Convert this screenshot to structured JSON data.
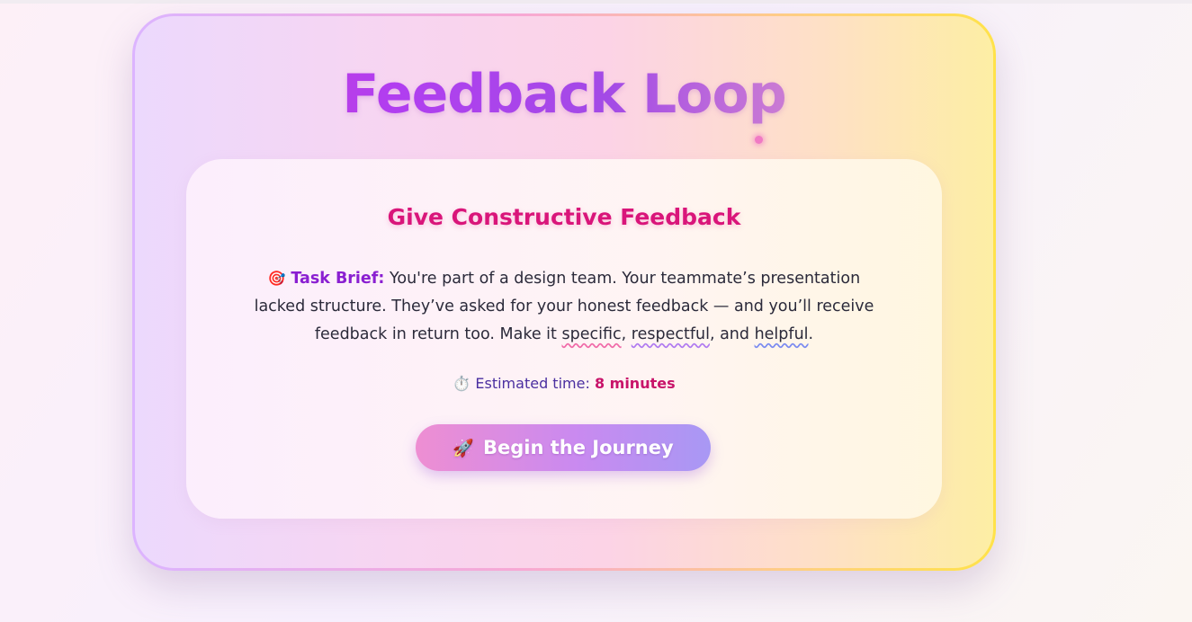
{
  "app": {
    "title": "Feedback Loop"
  },
  "card": {
    "heading": "Give Constructive Feedback",
    "brief": {
      "icon": "target-icon",
      "icon_glyph": "🎯",
      "label": "Task Brief:",
      "text_before": "You're part of a design team. Your teammate’s presentation lacked structure. They’ve asked for your honest feedback — and you’ll receive feedback in return too. Make it",
      "word_1": "specific",
      "sep_1": ",",
      "word_2": "respectful",
      "sep_2": ", and",
      "word_3": "helpful",
      "end": "."
    },
    "time": {
      "icon": "stopwatch-icon",
      "icon_glyph": "⏱️",
      "label": "Estimated time:",
      "value": "8 minutes"
    },
    "cta": {
      "icon": "rocket-icon",
      "icon_glyph": "🚀",
      "label": "Begin the Journey"
    }
  },
  "colors": {
    "heading": "#d9157a",
    "brief_label": "#8a1fd1",
    "time_label": "#4a2fa0",
    "time_value": "#c8146a",
    "button_gradient_start": "#ee8ed2",
    "button_gradient_end": "#a898f4"
  }
}
